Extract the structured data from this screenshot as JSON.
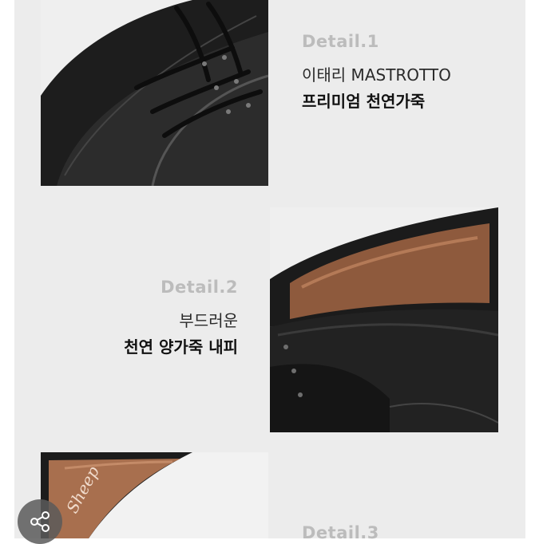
{
  "details": [
    {
      "title": "Detail.1",
      "line1": "이태리 MASTROTTO",
      "line2": "프리미엄 천연가죽"
    },
    {
      "title": "Detail.2",
      "line1": "부드러운",
      "line2": "천연 양가죽 내피"
    },
    {
      "title": "Detail.3"
    }
  ],
  "insole_text": "Sheep"
}
